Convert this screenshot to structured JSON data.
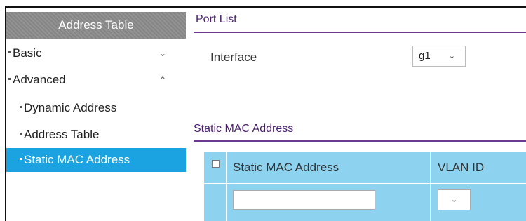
{
  "sidebar": {
    "header": "Address Table",
    "items": [
      {
        "label": "Basic",
        "chevron": "chevron-down"
      },
      {
        "label": "Advanced",
        "chevron": "chevron-up"
      },
      {
        "label": "Dynamic Address"
      },
      {
        "label": "Address Table"
      },
      {
        "label": "Static MAC Address",
        "active": true
      }
    ]
  },
  "port_list": {
    "title": "Port List",
    "interface_label": "Interface",
    "interface_value": "g1"
  },
  "static_mac": {
    "title": "Static MAC Address",
    "columns": [
      "Static MAC Address",
      "VLAN ID"
    ],
    "new_row": {
      "mac_value": "",
      "vlan_value": ""
    }
  },
  "colors": {
    "accent_purple": "#6b3a8e",
    "active_blue": "#1aa3e0",
    "table_blue": "#8dd3f0",
    "header_gray": "#8c8c8c"
  }
}
